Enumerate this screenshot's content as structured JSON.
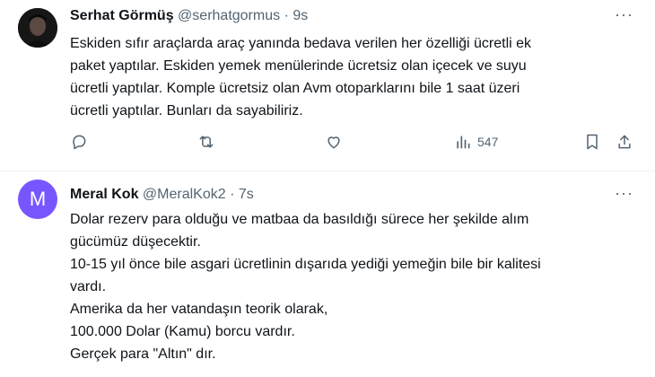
{
  "tweets": [
    {
      "name": "Serhat Görmüş",
      "handle": "@serhatgormus",
      "time": "· 9s",
      "more": "···",
      "lines": [
        "Eskiden sıfır araçlarda araç yanında bedava verilen her özelliği ücretli ek",
        "paket yaptılar. Eskiden yemek menülerinde ücretsiz olan içecek ve suyu",
        "ücretli yaptılar. Komple ücretsiz olan Avm otoparklarını bile 1 saat üzeri",
        "ücretli yaptılar. Bunları da sayabiliriz."
      ],
      "views": "547"
    },
    {
      "avatar_letter": "M",
      "avatar_color": "#7856ff",
      "name": "Meral Kok",
      "handle": "@MeralKok2",
      "time": "· 7s",
      "more": "···",
      "lines": [
        "Dolar rezerv para olduğu ve matbaa da basıldığı sürece her şekilde alım",
        "gücümüz düşecektir.",
        "10-15 yıl önce bile asgari ücretlinin dışarıda yediği yemeğin bile bir kalitesi",
        "vardı.",
        "Amerika da her vatandaşın teorik olarak,",
        "100.000 Dolar (Kamu) borcu vardır.",
        "Gerçek para \"Altın\" dır."
      ]
    }
  ],
  "icons": {
    "reply": "reply-icon",
    "retweet": "retweet-icon",
    "like": "like-icon",
    "views": "views-icon",
    "bookmark": "bookmark-icon",
    "share": "share-icon"
  }
}
